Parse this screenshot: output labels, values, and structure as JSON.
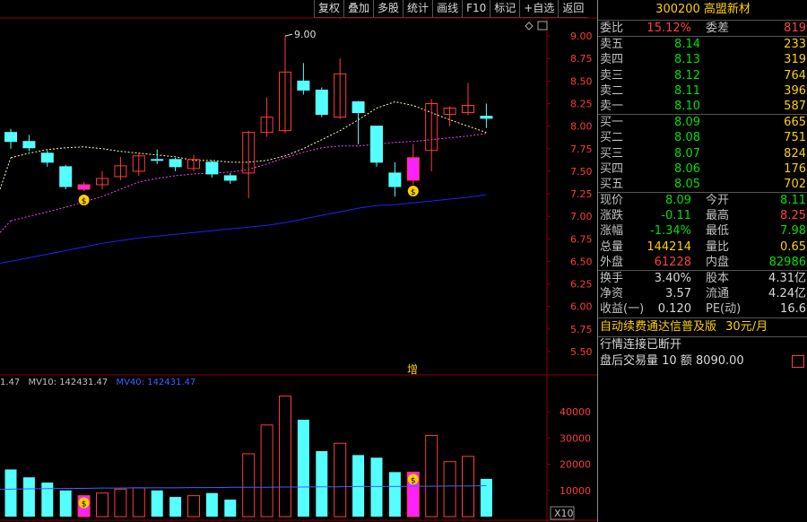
{
  "toolbar": [
    "复权",
    "叠加",
    "多股",
    "统计",
    "画线",
    "F10",
    "标记",
    "+自选",
    "返回"
  ],
  "stock": {
    "code": "300200",
    "name": "高盟新材"
  },
  "order_book": {
    "weibi_label": "委比",
    "weibi": "15.12%",
    "weicha_label": "委差",
    "weicha": "819",
    "asks": [
      {
        "label": "卖五",
        "price": "8.14",
        "qty": "233"
      },
      {
        "label": "卖四",
        "price": "8.13",
        "qty": "319"
      },
      {
        "label": "卖三",
        "price": "8.12",
        "qty": "764"
      },
      {
        "label": "卖二",
        "price": "8.11",
        "qty": "396"
      },
      {
        "label": "卖一",
        "price": "8.10",
        "qty": "587"
      }
    ],
    "bids": [
      {
        "label": "买一",
        "price": "8.09",
        "qty": "665"
      },
      {
        "label": "买二",
        "price": "8.08",
        "qty": "751"
      },
      {
        "label": "买三",
        "price": "8.07",
        "qty": "824"
      },
      {
        "label": "买四",
        "price": "8.06",
        "qty": "176"
      },
      {
        "label": "买五",
        "price": "8.05",
        "qty": "702"
      }
    ]
  },
  "quote": [
    {
      "l": "现价",
      "v": "8.09",
      "vc": "#00e000",
      "l2": "今开",
      "v2": "8.11",
      "v2c": "#00e000"
    },
    {
      "l": "涨跌",
      "v": "-0.11",
      "vc": "#00e000",
      "l2": "最高",
      "v2": "8.25",
      "v2c": "#ff4040"
    },
    {
      "l": "涨幅",
      "v": "-1.34%",
      "vc": "#00e000",
      "l2": "最低",
      "v2": "7.98",
      "v2c": "#00e000"
    },
    {
      "l": "总量",
      "v": "144214",
      "vc": "#ffd000",
      "l2": "量比",
      "v2": "0.65",
      "v2c": "#ffd000"
    },
    {
      "l": "外盘",
      "v": "61228",
      "vc": "#ff4040",
      "l2": "内盘",
      "v2": "82986",
      "v2c": "#00e000"
    }
  ],
  "fund": [
    {
      "l": "换手",
      "v": "3.40%",
      "l2": "股本",
      "v2": "4.31亿"
    },
    {
      "l": "净资",
      "v": "3.57",
      "l2": "流通",
      "v2": "4.24亿"
    },
    {
      "l": "收益(一)",
      "v": "0.120",
      "l2": "PE(动)",
      "v2": "16.6"
    }
  ],
  "ad_text": "自动续费通达信普及版",
  "ad_price": "30元/月",
  "status_msg": "行情连接已断开",
  "after_hours": "盘后交易量 10 额 8090.00",
  "vol_legend": {
    "vol": "1.47",
    "mv10": "MV10: 142431.47",
    "mv40": "MV40: 142431.47"
  },
  "vol_axis": [
    "40000",
    "30000",
    "20000",
    "10000"
  ],
  "vol_unit": "X10",
  "price_axis": [
    "9.00",
    "8.75",
    "8.50",
    "8.25",
    "8.00",
    "7.75",
    "7.50",
    "7.25",
    "7.00",
    "6.75",
    "6.50",
    "6.25",
    "6.00",
    "5.75",
    "5.50"
  ],
  "high_marker": "9.00",
  "zeng_label": "增",
  "colors": {
    "up": "#ff3c3c",
    "down": "#54ffff",
    "ma5": "#ffffa0",
    "ma10": "#ff40ff",
    "ma60": "#2020ff"
  },
  "chart_data": {
    "type": "candlestick",
    "price_range": [
      5.4,
      9.2
    ],
    "volume_range": [
      0,
      50000
    ],
    "candles": [
      {
        "o": 7.93,
        "c": 7.83,
        "h": 7.97,
        "l": 7.75,
        "v": 18000
      },
      {
        "o": 7.83,
        "c": 7.76,
        "h": 7.9,
        "l": 7.72,
        "v": 15000
      },
      {
        "o": 7.7,
        "c": 7.6,
        "h": 7.73,
        "l": 7.55,
        "v": 13000
      },
      {
        "o": 7.55,
        "c": 7.33,
        "h": 7.57,
        "l": 7.3,
        "v": 10000
      },
      {
        "o": 7.3,
        "c": 7.35,
        "h": 7.38,
        "l": 7.28,
        "v": 8000,
        "marker": true
      },
      {
        "o": 7.35,
        "c": 7.42,
        "h": 7.5,
        "l": 7.3,
        "v": 9000
      },
      {
        "o": 7.44,
        "c": 7.56,
        "h": 7.66,
        "l": 7.4,
        "v": 10500
      },
      {
        "o": 7.5,
        "c": 7.67,
        "h": 7.7,
        "l": 7.45,
        "v": 11000
      },
      {
        "o": 7.63,
        "c": 7.63,
        "h": 7.74,
        "l": 7.58,
        "v": 10000
      },
      {
        "o": 7.63,
        "c": 7.55,
        "h": 7.65,
        "l": 7.5,
        "v": 7500
      },
      {
        "o": 7.53,
        "c": 7.63,
        "h": 7.68,
        "l": 7.5,
        "v": 8000
      },
      {
        "o": 7.6,
        "c": 7.47,
        "h": 7.62,
        "l": 7.43,
        "v": 9000
      },
      {
        "o": 7.45,
        "c": 7.4,
        "h": 7.48,
        "l": 7.36,
        "v": 6500
      },
      {
        "o": 7.48,
        "c": 7.93,
        "h": 7.95,
        "l": 7.2,
        "v": 24000
      },
      {
        "o": 7.93,
        "c": 8.1,
        "h": 8.32,
        "l": 7.88,
        "v": 35000
      },
      {
        "o": 7.95,
        "c": 8.6,
        "h": 9.0,
        "l": 7.92,
        "v": 46000
      },
      {
        "o": 8.5,
        "c": 8.4,
        "h": 8.7,
        "l": 8.35,
        "v": 37000
      },
      {
        "o": 8.4,
        "c": 8.13,
        "h": 8.43,
        "l": 8.1,
        "v": 25000
      },
      {
        "o": 8.1,
        "c": 8.58,
        "h": 8.75,
        "l": 8.08,
        "v": 28000
      },
      {
        "o": 8.27,
        "c": 8.15,
        "h": 8.28,
        "l": 7.8,
        "v": 23500
      },
      {
        "o": 8.0,
        "c": 7.6,
        "h": 8.0,
        "l": 7.55,
        "v": 22500
      },
      {
        "o": 7.48,
        "c": 7.33,
        "h": 7.6,
        "l": 7.22,
        "v": 17000
      },
      {
        "o": 7.4,
        "c": 7.65,
        "h": 7.8,
        "l": 7.35,
        "v": 17000,
        "marker": true
      },
      {
        "o": 7.73,
        "c": 8.25,
        "h": 8.3,
        "l": 7.5,
        "v": 31000
      },
      {
        "o": 8.13,
        "c": 8.2,
        "h": 8.22,
        "l": 8.0,
        "v": 21000
      },
      {
        "o": 8.15,
        "c": 8.23,
        "h": 8.48,
        "l": 8.12,
        "v": 23000
      },
      {
        "o": 8.11,
        "c": 8.09,
        "h": 8.25,
        "l": 7.98,
        "v": 14421
      }
    ],
    "ma5": [
      7.65,
      7.7,
      7.74,
      7.76,
      7.77,
      7.75,
      7.72,
      7.7,
      7.68,
      7.66,
      7.62,
      7.62,
      7.6,
      7.6,
      7.62,
      7.67,
      7.75,
      7.85,
      7.95,
      8.07,
      8.2,
      8.27,
      8.23,
      8.15,
      8.07,
      8.0,
      7.93
    ],
    "ma10": [
      6.95,
      7.0,
      7.05,
      7.1,
      7.16,
      7.22,
      7.3,
      7.38,
      7.42,
      7.45,
      7.47,
      7.48,
      7.49,
      7.52,
      7.58,
      7.65,
      7.71,
      7.76,
      7.78,
      7.78,
      7.8,
      7.82,
      7.83,
      7.85,
      7.87,
      7.89,
      7.92
    ],
    "ma60": [
      6.5,
      6.54,
      6.58,
      6.62,
      6.66,
      6.7,
      6.73,
      6.76,
      6.78,
      6.8,
      6.82,
      6.84,
      6.86,
      6.88,
      6.9,
      6.93,
      6.97,
      7.01,
      7.05,
      7.09,
      7.12,
      7.13,
      7.15,
      7.17,
      7.19,
      7.21,
      7.24
    ],
    "vol_ma": [
      10500,
      10600,
      10700,
      10800,
      10800,
      10900,
      10900,
      11000,
      11000,
      11000,
      11100,
      11100,
      11200,
      11200,
      11200,
      11300,
      11300,
      11400,
      11400,
      11500,
      11500,
      11500,
      11600,
      11600,
      11700,
      11700,
      11800
    ]
  }
}
